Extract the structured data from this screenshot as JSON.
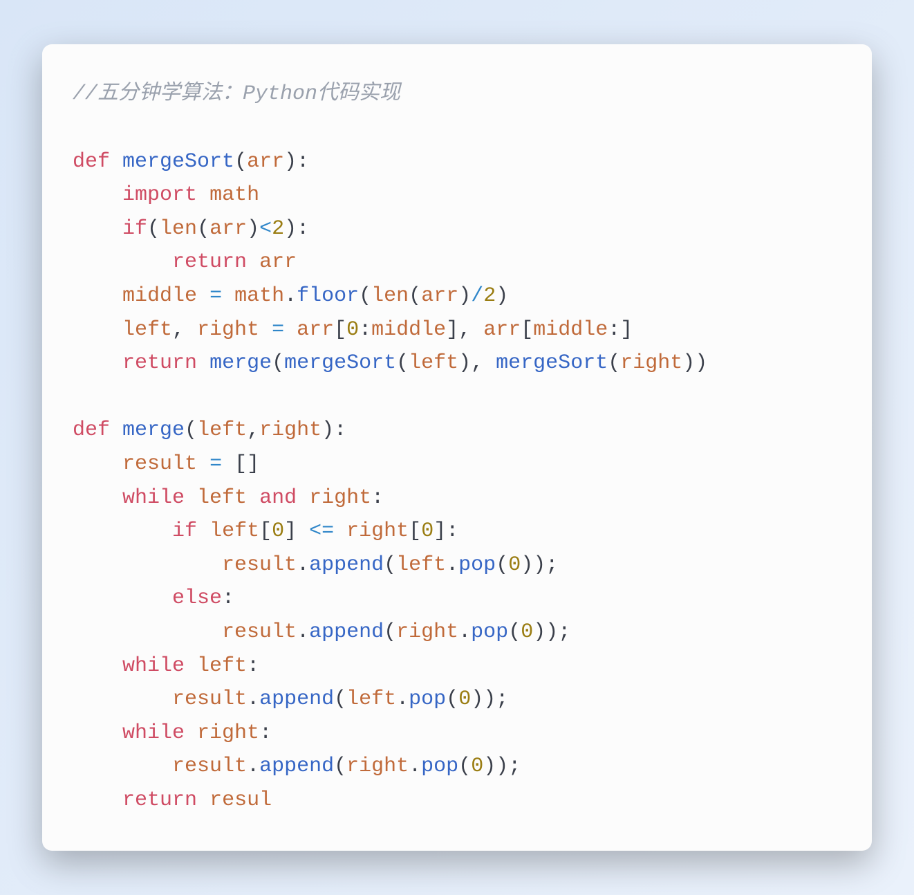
{
  "code": {
    "lines": [
      [
        {
          "cls": "tok-comment",
          "text": "//五分钟学算法：Python代码实现"
        }
      ],
      [],
      [
        {
          "cls": "tok-kw",
          "text": "def"
        },
        {
          "cls": "tok-punc",
          "text": " "
        },
        {
          "cls": "tok-fn",
          "text": "mergeSort"
        },
        {
          "cls": "tok-punc",
          "text": "("
        },
        {
          "cls": "tok-var",
          "text": "arr"
        },
        {
          "cls": "tok-punc",
          "text": "):"
        }
      ],
      [
        {
          "cls": "tok-punc",
          "text": "    "
        },
        {
          "cls": "tok-kw",
          "text": "import"
        },
        {
          "cls": "tok-punc",
          "text": " "
        },
        {
          "cls": "tok-var",
          "text": "math"
        }
      ],
      [
        {
          "cls": "tok-punc",
          "text": "    "
        },
        {
          "cls": "tok-kw",
          "text": "if"
        },
        {
          "cls": "tok-punc",
          "text": "("
        },
        {
          "cls": "tok-var",
          "text": "len"
        },
        {
          "cls": "tok-punc",
          "text": "("
        },
        {
          "cls": "tok-var",
          "text": "arr"
        },
        {
          "cls": "tok-punc",
          "text": ")"
        },
        {
          "cls": "tok-op",
          "text": "<"
        },
        {
          "cls": "tok-num",
          "text": "2"
        },
        {
          "cls": "tok-punc",
          "text": "):"
        }
      ],
      [
        {
          "cls": "tok-punc",
          "text": "        "
        },
        {
          "cls": "tok-kw",
          "text": "return"
        },
        {
          "cls": "tok-punc",
          "text": " "
        },
        {
          "cls": "tok-var",
          "text": "arr"
        }
      ],
      [
        {
          "cls": "tok-punc",
          "text": "    "
        },
        {
          "cls": "tok-var",
          "text": "middle"
        },
        {
          "cls": "tok-punc",
          "text": " "
        },
        {
          "cls": "tok-op",
          "text": "="
        },
        {
          "cls": "tok-punc",
          "text": " "
        },
        {
          "cls": "tok-var",
          "text": "math"
        },
        {
          "cls": "tok-punc",
          "text": "."
        },
        {
          "cls": "tok-fn",
          "text": "floor"
        },
        {
          "cls": "tok-punc",
          "text": "("
        },
        {
          "cls": "tok-var",
          "text": "len"
        },
        {
          "cls": "tok-punc",
          "text": "("
        },
        {
          "cls": "tok-var",
          "text": "arr"
        },
        {
          "cls": "tok-punc",
          "text": ")"
        },
        {
          "cls": "tok-op",
          "text": "/"
        },
        {
          "cls": "tok-num",
          "text": "2"
        },
        {
          "cls": "tok-punc",
          "text": ")"
        }
      ],
      [
        {
          "cls": "tok-punc",
          "text": "    "
        },
        {
          "cls": "tok-var",
          "text": "left"
        },
        {
          "cls": "tok-punc",
          "text": ", "
        },
        {
          "cls": "tok-var",
          "text": "right"
        },
        {
          "cls": "tok-punc",
          "text": " "
        },
        {
          "cls": "tok-op",
          "text": "="
        },
        {
          "cls": "tok-punc",
          "text": " "
        },
        {
          "cls": "tok-var",
          "text": "arr"
        },
        {
          "cls": "tok-punc",
          "text": "["
        },
        {
          "cls": "tok-num",
          "text": "0"
        },
        {
          "cls": "tok-punc",
          "text": ":"
        },
        {
          "cls": "tok-var",
          "text": "middle"
        },
        {
          "cls": "tok-punc",
          "text": "], "
        },
        {
          "cls": "tok-var",
          "text": "arr"
        },
        {
          "cls": "tok-punc",
          "text": "["
        },
        {
          "cls": "tok-var",
          "text": "middle"
        },
        {
          "cls": "tok-punc",
          "text": ":]"
        }
      ],
      [
        {
          "cls": "tok-punc",
          "text": "    "
        },
        {
          "cls": "tok-kw",
          "text": "return"
        },
        {
          "cls": "tok-punc",
          "text": " "
        },
        {
          "cls": "tok-fn",
          "text": "merge"
        },
        {
          "cls": "tok-punc",
          "text": "("
        },
        {
          "cls": "tok-fn",
          "text": "mergeSort"
        },
        {
          "cls": "tok-punc",
          "text": "("
        },
        {
          "cls": "tok-var",
          "text": "left"
        },
        {
          "cls": "tok-punc",
          "text": "), "
        },
        {
          "cls": "tok-fn",
          "text": "mergeSort"
        },
        {
          "cls": "tok-punc",
          "text": "("
        },
        {
          "cls": "tok-var",
          "text": "right"
        },
        {
          "cls": "tok-punc",
          "text": "))"
        }
      ],
      [],
      [
        {
          "cls": "tok-kw",
          "text": "def"
        },
        {
          "cls": "tok-punc",
          "text": " "
        },
        {
          "cls": "tok-fn",
          "text": "merge"
        },
        {
          "cls": "tok-punc",
          "text": "("
        },
        {
          "cls": "tok-var",
          "text": "left"
        },
        {
          "cls": "tok-punc",
          "text": ","
        },
        {
          "cls": "tok-var",
          "text": "right"
        },
        {
          "cls": "tok-punc",
          "text": "):"
        }
      ],
      [
        {
          "cls": "tok-punc",
          "text": "    "
        },
        {
          "cls": "tok-var",
          "text": "result"
        },
        {
          "cls": "tok-punc",
          "text": " "
        },
        {
          "cls": "tok-op",
          "text": "="
        },
        {
          "cls": "tok-punc",
          "text": " []"
        }
      ],
      [
        {
          "cls": "tok-punc",
          "text": "    "
        },
        {
          "cls": "tok-kw",
          "text": "while"
        },
        {
          "cls": "tok-punc",
          "text": " "
        },
        {
          "cls": "tok-var",
          "text": "left"
        },
        {
          "cls": "tok-punc",
          "text": " "
        },
        {
          "cls": "tok-kw",
          "text": "and"
        },
        {
          "cls": "tok-punc",
          "text": " "
        },
        {
          "cls": "tok-var",
          "text": "right"
        },
        {
          "cls": "tok-punc",
          "text": ":"
        }
      ],
      [
        {
          "cls": "tok-punc",
          "text": "        "
        },
        {
          "cls": "tok-kw",
          "text": "if"
        },
        {
          "cls": "tok-punc",
          "text": " "
        },
        {
          "cls": "tok-var",
          "text": "left"
        },
        {
          "cls": "tok-punc",
          "text": "["
        },
        {
          "cls": "tok-num",
          "text": "0"
        },
        {
          "cls": "tok-punc",
          "text": "] "
        },
        {
          "cls": "tok-op",
          "text": "<="
        },
        {
          "cls": "tok-punc",
          "text": " "
        },
        {
          "cls": "tok-var",
          "text": "right"
        },
        {
          "cls": "tok-punc",
          "text": "["
        },
        {
          "cls": "tok-num",
          "text": "0"
        },
        {
          "cls": "tok-punc",
          "text": "]:"
        }
      ],
      [
        {
          "cls": "tok-punc",
          "text": "            "
        },
        {
          "cls": "tok-var",
          "text": "result"
        },
        {
          "cls": "tok-punc",
          "text": "."
        },
        {
          "cls": "tok-fn",
          "text": "append"
        },
        {
          "cls": "tok-punc",
          "text": "("
        },
        {
          "cls": "tok-var",
          "text": "left"
        },
        {
          "cls": "tok-punc",
          "text": "."
        },
        {
          "cls": "tok-fn",
          "text": "pop"
        },
        {
          "cls": "tok-punc",
          "text": "("
        },
        {
          "cls": "tok-num",
          "text": "0"
        },
        {
          "cls": "tok-punc",
          "text": "));"
        }
      ],
      [
        {
          "cls": "tok-punc",
          "text": "        "
        },
        {
          "cls": "tok-kw",
          "text": "else"
        },
        {
          "cls": "tok-punc",
          "text": ":"
        }
      ],
      [
        {
          "cls": "tok-punc",
          "text": "            "
        },
        {
          "cls": "tok-var",
          "text": "result"
        },
        {
          "cls": "tok-punc",
          "text": "."
        },
        {
          "cls": "tok-fn",
          "text": "append"
        },
        {
          "cls": "tok-punc",
          "text": "("
        },
        {
          "cls": "tok-var",
          "text": "right"
        },
        {
          "cls": "tok-punc",
          "text": "."
        },
        {
          "cls": "tok-fn",
          "text": "pop"
        },
        {
          "cls": "tok-punc",
          "text": "("
        },
        {
          "cls": "tok-num",
          "text": "0"
        },
        {
          "cls": "tok-punc",
          "text": "));"
        }
      ],
      [
        {
          "cls": "tok-punc",
          "text": "    "
        },
        {
          "cls": "tok-kw",
          "text": "while"
        },
        {
          "cls": "tok-punc",
          "text": " "
        },
        {
          "cls": "tok-var",
          "text": "left"
        },
        {
          "cls": "tok-punc",
          "text": ":"
        }
      ],
      [
        {
          "cls": "tok-punc",
          "text": "        "
        },
        {
          "cls": "tok-var",
          "text": "result"
        },
        {
          "cls": "tok-punc",
          "text": "."
        },
        {
          "cls": "tok-fn",
          "text": "append"
        },
        {
          "cls": "tok-punc",
          "text": "("
        },
        {
          "cls": "tok-var",
          "text": "left"
        },
        {
          "cls": "tok-punc",
          "text": "."
        },
        {
          "cls": "tok-fn",
          "text": "pop"
        },
        {
          "cls": "tok-punc",
          "text": "("
        },
        {
          "cls": "tok-num",
          "text": "0"
        },
        {
          "cls": "tok-punc",
          "text": "));"
        }
      ],
      [
        {
          "cls": "tok-punc",
          "text": "    "
        },
        {
          "cls": "tok-kw",
          "text": "while"
        },
        {
          "cls": "tok-punc",
          "text": " "
        },
        {
          "cls": "tok-var",
          "text": "right"
        },
        {
          "cls": "tok-punc",
          "text": ":"
        }
      ],
      [
        {
          "cls": "tok-punc",
          "text": "        "
        },
        {
          "cls": "tok-var",
          "text": "result"
        },
        {
          "cls": "tok-punc",
          "text": "."
        },
        {
          "cls": "tok-fn",
          "text": "append"
        },
        {
          "cls": "tok-punc",
          "text": "("
        },
        {
          "cls": "tok-var",
          "text": "right"
        },
        {
          "cls": "tok-punc",
          "text": "."
        },
        {
          "cls": "tok-fn",
          "text": "pop"
        },
        {
          "cls": "tok-punc",
          "text": "("
        },
        {
          "cls": "tok-num",
          "text": "0"
        },
        {
          "cls": "tok-punc",
          "text": "));"
        }
      ],
      [
        {
          "cls": "tok-punc",
          "text": "    "
        },
        {
          "cls": "tok-kw",
          "text": "return"
        },
        {
          "cls": "tok-punc",
          "text": " "
        },
        {
          "cls": "tok-var",
          "text": "resul"
        }
      ]
    ]
  }
}
